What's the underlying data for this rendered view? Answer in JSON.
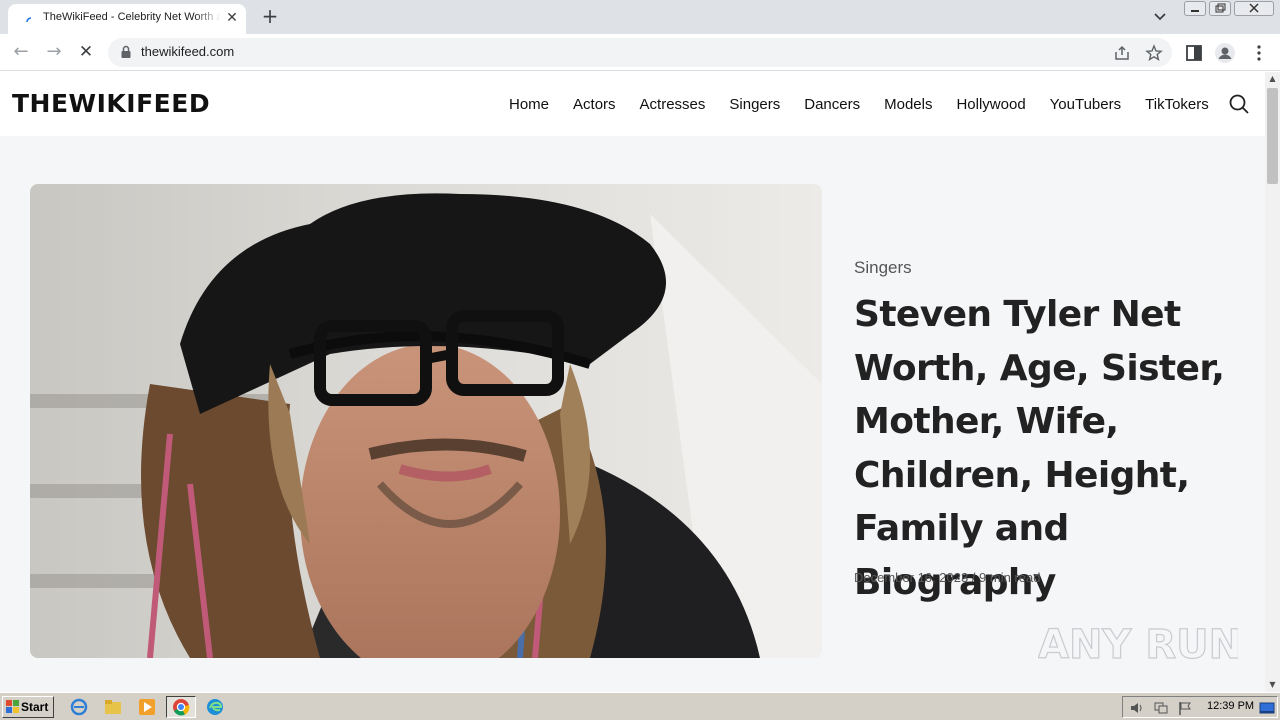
{
  "browser": {
    "tab_title": "TheWikiFeed - Celebrity Net Worth and",
    "tab_close": "✕",
    "new_tab": "+",
    "url": "thewikifeed.com",
    "back": "←",
    "forward": "→",
    "reload": "✕"
  },
  "site": {
    "logo": "THEWIKIFEED",
    "nav": [
      "Home",
      "Actors",
      "Actresses",
      "Singers",
      "Dancers",
      "Models",
      "Hollywood",
      "YouTubers",
      "TikTokers"
    ]
  },
  "post": {
    "category": "Singers",
    "title": "Steven Tyler Net Worth, Age, Sister, Mother, Wife, Children, Height, Family and Biography",
    "meta": "December 16, 2023 / 9 min read"
  },
  "watermark": "ANY RUN",
  "taskbar": {
    "start_label": "Start",
    "clock": "12:39 PM"
  },
  "colors": {
    "page_bg": "#f5f6f8",
    "header_bg": "#ffffff",
    "logo_accent": "#c8102e",
    "taskbar_bg": "#d4d0c8"
  }
}
